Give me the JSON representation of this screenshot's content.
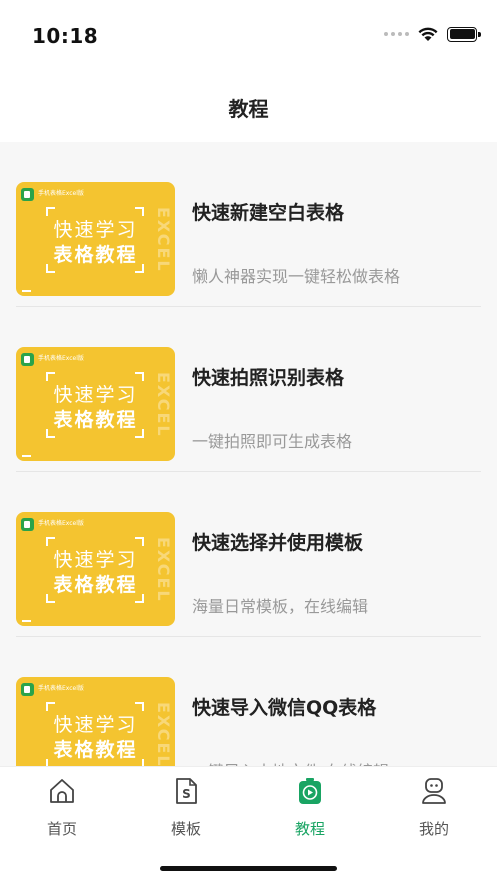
{
  "status_bar": {
    "time": "10:18"
  },
  "nav": {
    "title": "教程"
  },
  "thumbnail": {
    "brand": "手机表格Excel版",
    "line1": "快速学习",
    "line2": "表格教程",
    "side_text": "EXCEL"
  },
  "tutorials": [
    {
      "title": "快速新建空白表格",
      "subtitle": "懒人神器实现一键轻松做表格"
    },
    {
      "title": "快速拍照识别表格",
      "subtitle": "一键拍照即可生成表格"
    },
    {
      "title": "快速选择并使用模板",
      "subtitle": "海量日常模板，在线编辑"
    },
    {
      "title": "快速导入微信QQ表格",
      "subtitle": "一键导入本地文件 在线编辑"
    }
  ],
  "tabs": [
    {
      "label": "首页",
      "icon": "home-icon",
      "active": false
    },
    {
      "label": "模板",
      "icon": "template-icon",
      "active": false
    },
    {
      "label": "教程",
      "icon": "video-icon",
      "active": true
    },
    {
      "label": "我的",
      "icon": "profile-icon",
      "active": false
    }
  ],
  "colors": {
    "accent": "#19a463",
    "thumbnail_bg": "#f4c430"
  }
}
